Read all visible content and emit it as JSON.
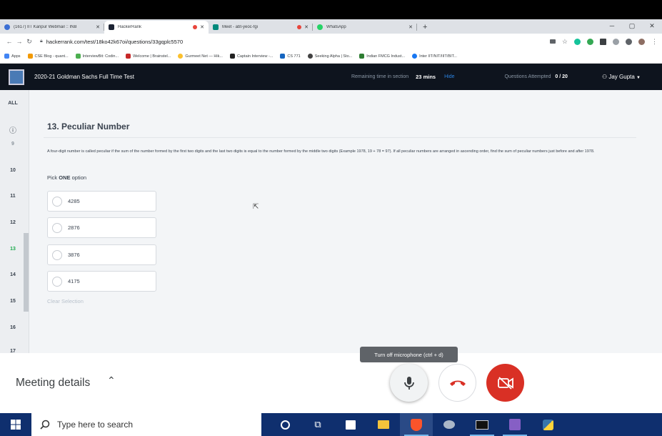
{
  "browser": {
    "tabs": [
      {
        "label": "(1617) IIT Kanpur Webmail :: INB",
        "active": false
      },
      {
        "label": "HackerRank",
        "active": true
      },
      {
        "label": "Meet - abt-yeoc-fgi",
        "active": false
      },
      {
        "label": "WhatsApp",
        "active": false
      }
    ],
    "new_tab": "+",
    "url": "hackerrank.com/test/18ko42k67oi/questions/33gqplc5570",
    "bookmarks": [
      "Apps",
      "CSE Blog - quant...",
      "InterviewBit: Codin...",
      "Welcome | Brainstel...",
      "Gurmeet Net — Hik...",
      "Captain Interview -...",
      "CS 771",
      "Seeking Alpha | Sto...",
      "Indian FMCG Indust...",
      "Inter IIT/NIT/IIIT/BIT..."
    ]
  },
  "header": {
    "test_title": "2020-21 Goldman Sachs Full Time Test",
    "remaining_label": "Remaining time in section",
    "remaining_value": "23 mins",
    "hide_label": "Hide",
    "attempted_label": "Questions Attempted",
    "attempted_value": "0 / 20",
    "user_name": "Jay Gupta"
  },
  "sidebar": {
    "all_label": "ALL",
    "numbers": [
      "9",
      "10",
      "11",
      "12",
      "13",
      "14",
      "15",
      "16",
      "17"
    ],
    "current": "13"
  },
  "question": {
    "title": "13. Peculiar Number",
    "text": "A four-digit number is called peculiar if the sum of the number formed by the first two digits and the last two digits is equal to the number formed by the middle two digits (Example 1978, 19 + 78 = 97). If all peculiar numbers are arranged in ascending order, find the sum of peculiar numbers just before and after 1978.",
    "pick_prefix": "Pick ",
    "pick_bold": "ONE",
    "pick_suffix": " option",
    "options": [
      "4285",
      "2876",
      "3876",
      "4175"
    ],
    "clear_label": "Clear Selection"
  },
  "meet": {
    "details_label": "Meeting details",
    "tooltip": "Turn off microphone (ctrl + d)"
  },
  "taskbar": {
    "search_placeholder": "Type here to search"
  },
  "colors": {
    "hr_header": "#0e141e",
    "hide_link": "#2b82e0",
    "hangup_red": "#d93025",
    "taskbar": "#0f2f6e"
  }
}
